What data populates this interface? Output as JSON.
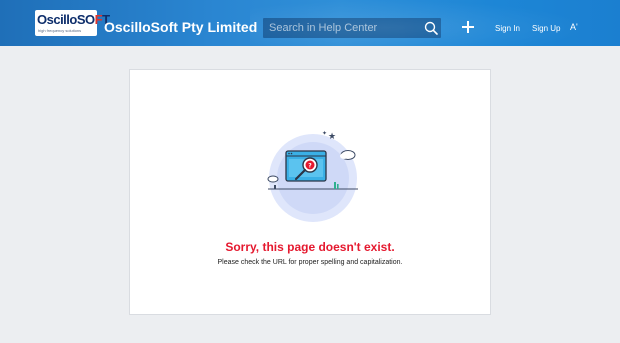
{
  "header": {
    "logo": {
      "text_main": "OscilloSO",
      "text_accent": "F",
      "text_end": "T",
      "tagline": "high frequency solutions"
    },
    "brand_name": "OscilloSoft Pty Limited",
    "search": {
      "placeholder": "Search in Help Center",
      "value": ""
    },
    "actions": {
      "sign_in": "Sign In",
      "sign_up": "Sign Up",
      "font_toggle": "A'"
    },
    "icons": {
      "search": "search-icon",
      "add": "plus-icon"
    }
  },
  "error": {
    "title": "Sorry, this page doesn't exist.",
    "message": "Please check the URL for proper spelling and capitalization.",
    "illustration": "magnifier-over-window-illustration"
  },
  "colors": {
    "header_blue": "#2a86d2",
    "error_red": "#e5192f",
    "background": "#eceef1",
    "card": "#ffffff"
  }
}
